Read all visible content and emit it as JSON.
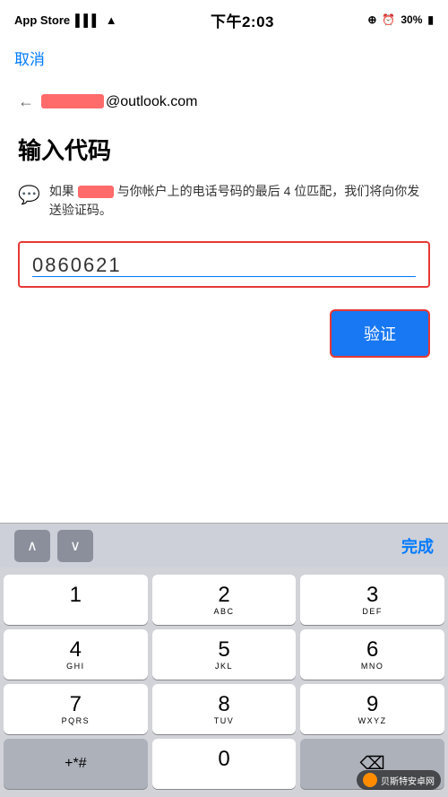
{
  "statusBar": {
    "appStore": "App Store",
    "time": "下午2:03",
    "battery": "30%"
  },
  "appBar": {
    "cancelLabel": "取消"
  },
  "email": {
    "backArrow": "←",
    "domain": "@outlook.com"
  },
  "page": {
    "title": "输入代码",
    "infoText1": "如果",
    "infoText2": "与你帐户上的电话号码的最后 4 位匹配，我们将向你发送验证码。",
    "codeValue": "0860621"
  },
  "buttons": {
    "verifyLabel": "验证",
    "doneLabel": "完成"
  },
  "keyboard": {
    "rows": [
      [
        {
          "number": "1",
          "letters": ""
        },
        {
          "number": "2",
          "letters": "ABC"
        },
        {
          "number": "3",
          "letters": "DEF"
        }
      ],
      [
        {
          "number": "4",
          "letters": "GHI"
        },
        {
          "number": "5",
          "letters": "JKL"
        },
        {
          "number": "6",
          "letters": "MNO"
        }
      ],
      [
        {
          "number": "7",
          "letters": "PQRS"
        },
        {
          "number": "8",
          "letters": "TUV"
        },
        {
          "number": "9",
          "letters": "WXYZ"
        }
      ],
      [
        {
          "number": "+*#",
          "letters": "",
          "special": true
        },
        {
          "number": "0",
          "letters": ""
        },
        {
          "number": "⌫",
          "letters": "",
          "special": true
        }
      ]
    ],
    "upArrow": "∧",
    "downArrow": "∨"
  },
  "watermark": {
    "text": "贝斯特安卓网"
  }
}
